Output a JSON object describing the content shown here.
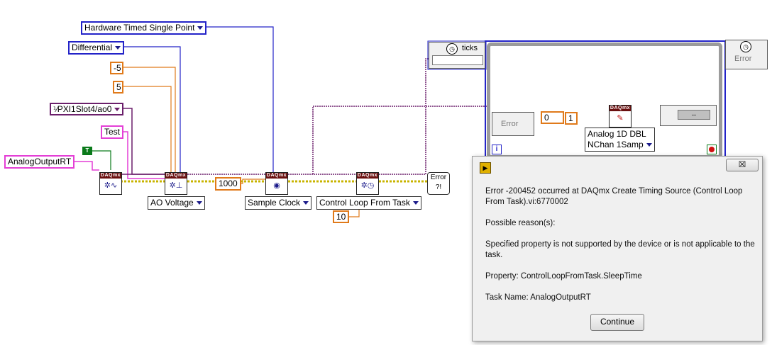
{
  "diagram": {
    "rings": {
      "timing_type": "Hardware Timed Single Point",
      "terminal": "Differential",
      "min_val": "-5",
      "max_val": "5",
      "channel": "PXI1Slot4/ao0",
      "task_name_const": "Test",
      "task_name": "AnalogOutputRT",
      "bool_const": "T",
      "rate": "1000",
      "sleep": "10"
    },
    "vi_header": "DAQmx",
    "selectors": {
      "ao_voltage": "AO Voltage",
      "sample_clock": "Sample Clock",
      "control_loop": "Control Loop From Task"
    },
    "loop": {
      "ticks_label": "ticks",
      "error_in": "Error",
      "error_out": "Error",
      "index": "0",
      "channels": "1",
      "write_type_line1": "Analog 1D DBL",
      "write_type_line2": "NChan 1Samp",
      "iteration": "i",
      "status_value": "--"
    }
  },
  "dialog": {
    "close_glyph": "☒",
    "error_line": "Error -200452 occurred at DAQmx Create Timing Source (Control Loop From Task).vi:6770002",
    "possible_reasons": "Possible reason(s):",
    "reason": "Specified property is not supported by the device or is not applicable to the task.",
    "property": "Property: ControlLoopFromTask.SleepTime",
    "task_name": "Task Name: AnalogOutputRT",
    "continue_label": "Continue"
  },
  "colors": {
    "enum_blue": "#2323c8",
    "string_pink": "#e43fd6",
    "numeric_orange": "#e07a1a",
    "task_purple": "#6b1f6b",
    "error_wire": "#c8b400"
  }
}
